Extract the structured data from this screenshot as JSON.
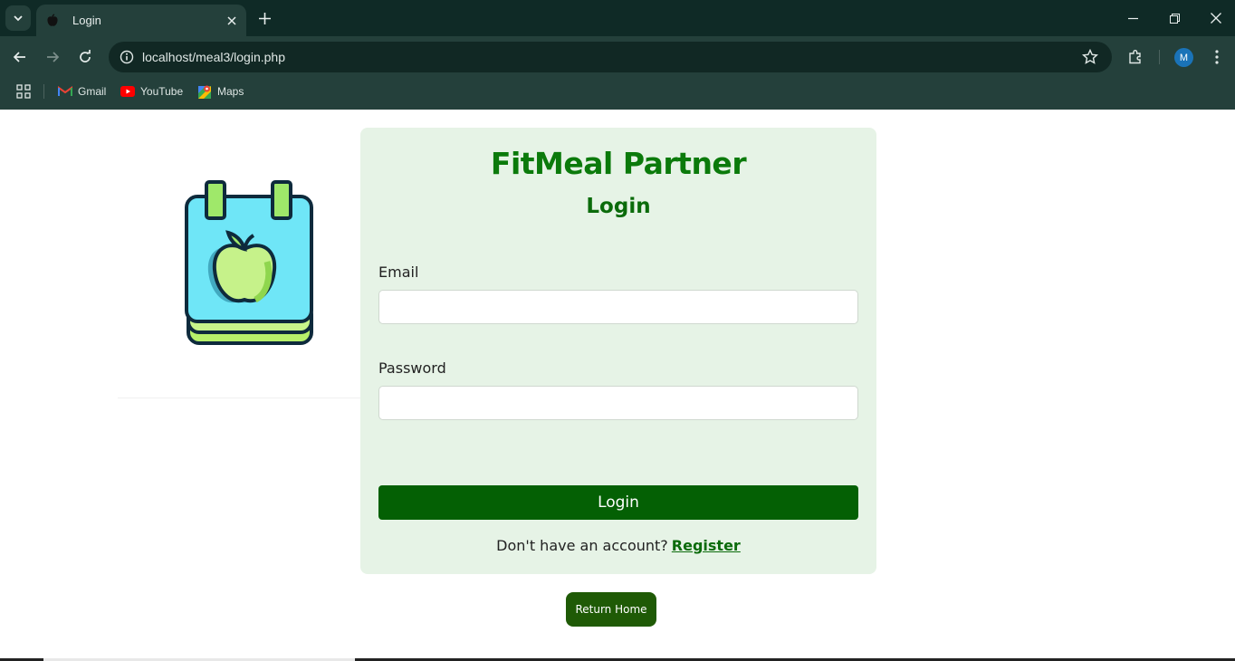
{
  "browser": {
    "tab": {
      "title": "Login"
    },
    "address_bar": {
      "url": "localhost/meal3/login.php"
    },
    "profile_initial": "M",
    "bookmarks": [
      {
        "label": "Gmail",
        "icon": "gmail-icon"
      },
      {
        "label": "YouTube",
        "icon": "youtube-icon"
      },
      {
        "label": "Maps",
        "icon": "maps-icon"
      }
    ],
    "colors": {
      "frame": "#0f2a26",
      "toolbar": "#24403b",
      "omnibox": "#112824"
    }
  },
  "page": {
    "logo": {
      "icon": "calendar-apple-logo"
    },
    "brand": "FitMeal Partner",
    "heading": "Login",
    "email": {
      "label": "Email",
      "value": "",
      "placeholder": ""
    },
    "password": {
      "label": "Password",
      "value": "",
      "placeholder": ""
    },
    "login_button": "Login",
    "register_prompt": "Don't have an account?",
    "register_link": "Register",
    "return_home_button": "Return Home",
    "colors": {
      "brand": "#0b7a0b",
      "card_bg": "#e6f3e6",
      "primary_button": "#046004",
      "home_button": "#1f5a06"
    }
  }
}
